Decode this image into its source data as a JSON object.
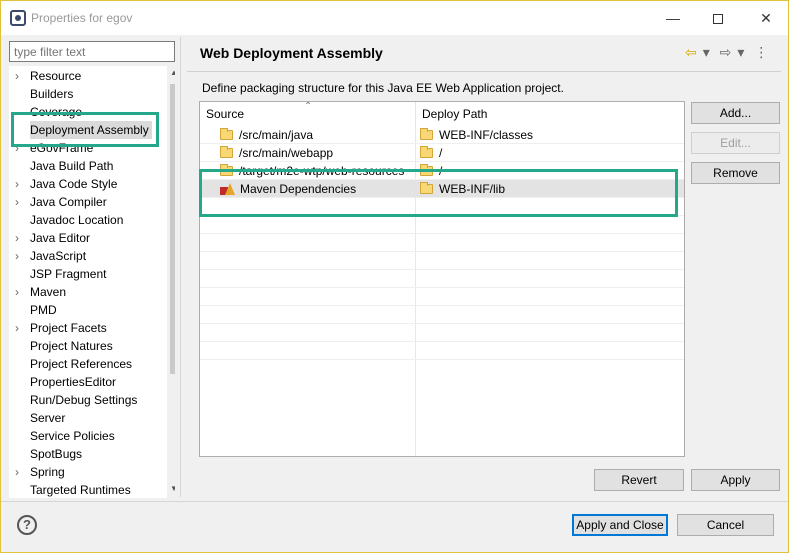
{
  "window": {
    "title": "Properties for egov",
    "minimize_glyph": "—",
    "close_glyph": "✕"
  },
  "filter": {
    "placeholder": "type filter text"
  },
  "tree": {
    "items": [
      {
        "label": "Resource",
        "expandable": true
      },
      {
        "label": "Builders",
        "expandable": false
      },
      {
        "label": "Coverage",
        "expandable": false
      },
      {
        "label": "Deployment Assembly",
        "expandable": false,
        "selected": true
      },
      {
        "label": "eGovFrame",
        "expandable": true
      },
      {
        "label": "Java Build Path",
        "expandable": false
      },
      {
        "label": "Java Code Style",
        "expandable": true
      },
      {
        "label": "Java Compiler",
        "expandable": true
      },
      {
        "label": "Javadoc Location",
        "expandable": false
      },
      {
        "label": "Java Editor",
        "expandable": true
      },
      {
        "label": "JavaScript",
        "expandable": true
      },
      {
        "label": "JSP Fragment",
        "expandable": false
      },
      {
        "label": "Maven",
        "expandable": true
      },
      {
        "label": "PMD",
        "expandable": false
      },
      {
        "label": "Project Facets",
        "expandable": true
      },
      {
        "label": "Project Natures",
        "expandable": false
      },
      {
        "label": "Project References",
        "expandable": false
      },
      {
        "label": "PropertiesEditor",
        "expandable": false
      },
      {
        "label": "Run/Debug Settings",
        "expandable": false
      },
      {
        "label": "Server",
        "expandable": false
      },
      {
        "label": "Service Policies",
        "expandable": false
      },
      {
        "label": "SpotBugs",
        "expandable": false
      },
      {
        "label": "Spring",
        "expandable": true
      },
      {
        "label": "Targeted Runtimes",
        "expandable": false
      }
    ]
  },
  "page": {
    "title": "Web Deployment Assembly",
    "description": "Define packaging structure for this Java EE Web Application project."
  },
  "table": {
    "columns": [
      "Source",
      "Deploy Path"
    ],
    "rows": [
      {
        "source": "/src/main/java",
        "deploy": "WEB-INF/classes",
        "icon": "folder-icon"
      },
      {
        "source": "/src/main/webapp",
        "deploy": "/",
        "icon": "folder-icon"
      },
      {
        "source": "/target/m2e-wtp/web-resources",
        "deploy": "/",
        "icon": "folder-icon"
      },
      {
        "source": "Maven Dependencies",
        "deploy": "WEB-INF/lib",
        "icon": "maven-library-icon",
        "selected": true
      }
    ]
  },
  "buttons": {
    "add": "Add...",
    "edit": "Edit...",
    "remove": "Remove",
    "revert": "Revert",
    "apply": "Apply",
    "apply_close": "Apply and Close",
    "cancel": "Cancel"
  },
  "accent": {
    "highlight": "#25a889",
    "selection": "#dadada"
  }
}
